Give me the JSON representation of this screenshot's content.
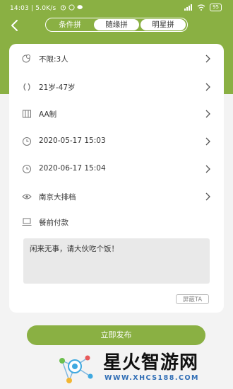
{
  "status_bar": {
    "time": "14:03",
    "speed": "5.0K/s",
    "battery": "95"
  },
  "tabs": [
    {
      "label": "条件拼",
      "active": true
    },
    {
      "label": "随缘拼",
      "active": false
    },
    {
      "label": "明星拼",
      "active": false
    }
  ],
  "form": {
    "rows": [
      {
        "icon": "people-icon",
        "value": "不限:3人",
        "has_chevron": true
      },
      {
        "icon": "age-range-icon",
        "value": "21岁-47岁",
        "has_chevron": true
      },
      {
        "icon": "split-bill-icon",
        "value": "AA制",
        "has_chevron": true
      },
      {
        "icon": "clock-icon",
        "value": "2020-05-17 15:03",
        "has_chevron": true
      },
      {
        "icon": "clock-icon",
        "value": "2020-06-17 15:04",
        "has_chevron": true
      },
      {
        "icon": "location-icon",
        "value": "南京大排档",
        "has_chevron": true
      },
      {
        "icon": "payment-icon",
        "value": "餐前付款",
        "has_chevron": false
      }
    ],
    "message": "闲来无事，请大伙吃个饭！",
    "hide_label": "屏蔽TA"
  },
  "publish_label": "立即发布",
  "watermark": {
    "title": "星火智游网",
    "url": "WWW.XHCS188.COM"
  },
  "colors": {
    "accent": "#8ab043",
    "background": "#f3f3f3"
  }
}
